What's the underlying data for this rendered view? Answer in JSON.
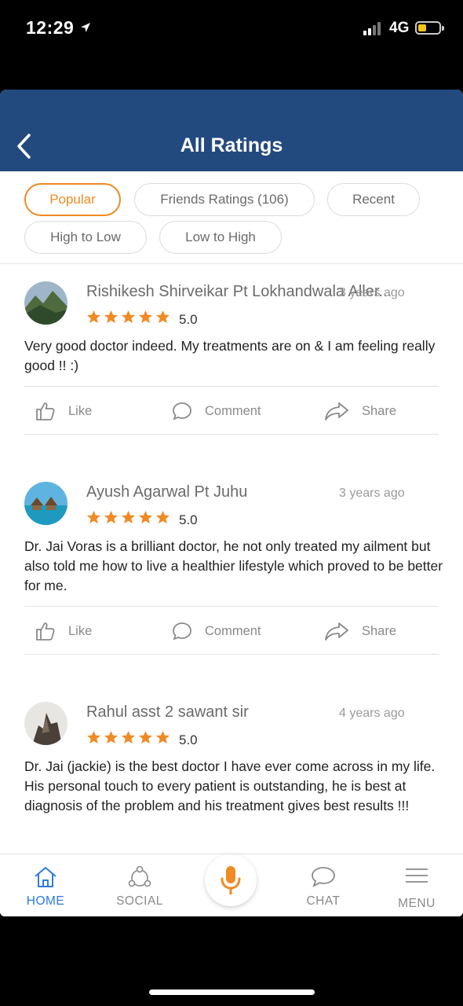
{
  "status_bar": {
    "time": "12:29",
    "network": "4G"
  },
  "header": {
    "title": "All Ratings"
  },
  "filters": [
    {
      "label": "Popular",
      "active": true
    },
    {
      "label": "Friends Ratings (106)",
      "active": false
    },
    {
      "label": "Recent",
      "active": false
    },
    {
      "label": "High to Low",
      "active": false
    },
    {
      "label": "Low to High",
      "active": false
    }
  ],
  "reviews": [
    {
      "name": "Rishikesh Shirveikar Pt Lokhandwala Aller...",
      "age": "3 years ago",
      "rating": "5.0",
      "text": "Very good doctor indeed. My treatments are on & I am feeling really good !! :)"
    },
    {
      "name": "Ayush Agarwal Pt Juhu",
      "age": "3 years ago",
      "rating": "5.0",
      "text": "Dr. Jai Voras is a brilliant doctor, he not only treated my ailment but also told me how to live a healthier lifestyle which proved to be better for me."
    },
    {
      "name": "Rahul asst 2 sawant sir",
      "age": "4 years ago",
      "rating": "5.0",
      "text": "Dr. Jai (jackie) is the best doctor I have ever come across in my life. His personal touch to every patient is outstanding, he is best at diagnosis of the problem and his treatment gives best results !!!"
    }
  ],
  "actions": {
    "like": "Like",
    "comment": "Comment",
    "share": "Share"
  },
  "nav": {
    "home": "HOME",
    "social": "SOCIAL",
    "chat": "CHAT",
    "menu": "MENU"
  },
  "colors": {
    "header": "#234a7f",
    "accent": "#f08a24",
    "active_nav": "#2d7be0"
  }
}
